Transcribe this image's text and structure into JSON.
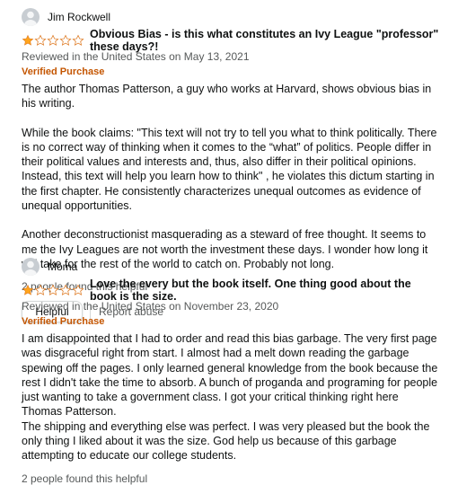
{
  "reviews": [
    {
      "reviewer": "Jim Rockwell",
      "rating": 1,
      "title": "Obvious Bias - is this what constitutes an Ivy League \"professor\" these days?!",
      "meta": "Reviewed in the United States on May 13, 2021",
      "verified": "Verified Purchase",
      "paragraphs": [
        "The author Thomas Patterson, a guy who works at Harvard, shows obvious bias in his writing.",
        "While the book claims: \"This text will not try to tell you what to think politically. There is no correct way of thinking when it comes to the “what” of politics. People differ in their political values and interests and, thus, also differ in their political opinions. Instead, this text will help you learn how to think\" , he violates this dictum starting in the first chapter. He consistently characterizes unequal outcomes as evidence of unequal opportunities.",
        "Another deconstructionist masquerading as a steward of free thought. It seems to me the Ivy Leagues are not worth the investment these days. I wonder how long it will take for the rest of the world to catch on. Probably not long."
      ],
      "helpful_count": "2 people found this helpful",
      "helpful_label": "Helpful",
      "report_label": "Report abuse"
    },
    {
      "reviewer": "Moma",
      "rating": 1,
      "title": "Love the every but the book itself. One thing good about the book is the size.",
      "meta": "Reviewed in the United States on November 23, 2020",
      "verified": "Verified Purchase",
      "lines": [
        "I am disappointed that I had to order and read this bias garbage. The very first page was disgraceful right from start. I almost had a melt down reading the garbage spewing off the pages. I only learned general knowledge from the book because the rest I didn't take the time to absorb. A bunch of proganda and programing for people just wanting to take a government class. I got your critical thinking right here Thomas Patterson.",
        "The shipping and everything else was perfect. I was very pleased but the book the only thing I liked about it was the size. God help us because of this garbage attempting to educate our college students."
      ],
      "helpful_count": "2 people found this helpful"
    }
  ],
  "colors": {
    "star": "#ffa41c",
    "verified": "#c45500",
    "meta": "#565959"
  }
}
